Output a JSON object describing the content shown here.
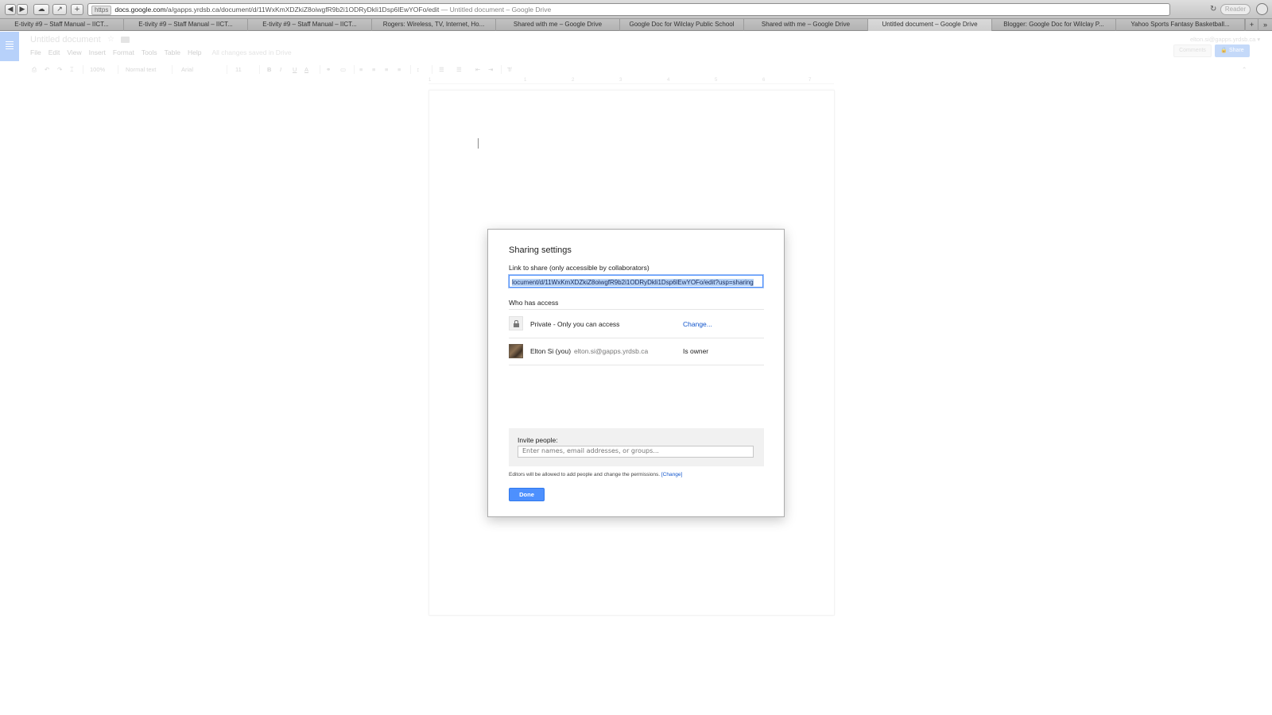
{
  "browser": {
    "nav_back": "◀",
    "nav_forward": "▶",
    "cloud_glyph": "☁",
    "share_glyph": "↗",
    "add_glyph": "+",
    "url_scheme": "https",
    "url_host": "docs.google.com",
    "url_path": "/a/gapps.yrdsb.ca/document/d/11WxKmXDZkiZ8oiwgfR9b2i1ODRyDkli1Dsp6lEwYOFo/edit",
    "url_title": "— Untitled document – Google Drive",
    "reload_glyph": "↻",
    "reader_label": "Reader"
  },
  "tabs": [
    {
      "label": "E-tivity #9 – Staff Manual – IICT..."
    },
    {
      "label": "E-tivity #9 – Staff Manual – IICT..."
    },
    {
      "label": "E-tivity #9 – Staff Manual – IICT..."
    },
    {
      "label": "Rogers: Wireless, TV, Internet, Ho..."
    },
    {
      "label": "Shared with me – Google Drive"
    },
    {
      "label": "Google Doc for Wilclay Public School"
    },
    {
      "label": "Shared with me – Google Drive"
    },
    {
      "label": "Untitled document – Google Drive"
    },
    {
      "label": "Blogger: Google Doc for Wilclay P..."
    },
    {
      "label": "Yahoo Sports Fantasy Basketball..."
    }
  ],
  "tab_extras": [
    "+",
    "»"
  ],
  "docs": {
    "title": "Untitled document",
    "star_glyph": "☆",
    "menu": [
      "File",
      "Edit",
      "View",
      "Insert",
      "Format",
      "Tools",
      "Table",
      "Help"
    ],
    "saved_status": "All changes saved in Drive",
    "user_email": "elton.si@gapps.yrdsb.ca ▾",
    "comments_label": "Comments",
    "share_label": "🔒 Share",
    "toolbar": {
      "zoom": "100%",
      "style": "Normal text",
      "font": "Arial",
      "size": "11",
      "bold": "B",
      "italic": "I",
      "underline": "U",
      "text_color": "A"
    },
    "ruler_marks": [
      "1",
      "1",
      "2",
      "3",
      "4",
      "5",
      "6",
      "7"
    ]
  },
  "modal": {
    "title": "Sharing settings",
    "link_label": "Link to share (only accessible by collaborators)",
    "link_value": "locument/d/11WxKmXDZkiZ8oiwgfR9b2i1ODRyDkli1Dsp6lEwYOFo/edit?usp=sharing",
    "who_has_access": "Who has access",
    "access_text": "Private - Only you can access",
    "change_link": "Change...",
    "user_name": "Elton Si (you)",
    "user_email": "elton.si@gapps.yrdsb.ca",
    "user_role": "Is owner",
    "invite_label": "Invite people:",
    "invite_placeholder": "Enter names, email addresses, or groups...",
    "editors_note": "Editors will be allowed to add people and change the permissions.",
    "editors_change": "[Change]",
    "done_label": "Done"
  },
  "colors": {
    "accent": "#4d90fe",
    "link": "#1155cc",
    "docs_brand": "#4285f4"
  }
}
